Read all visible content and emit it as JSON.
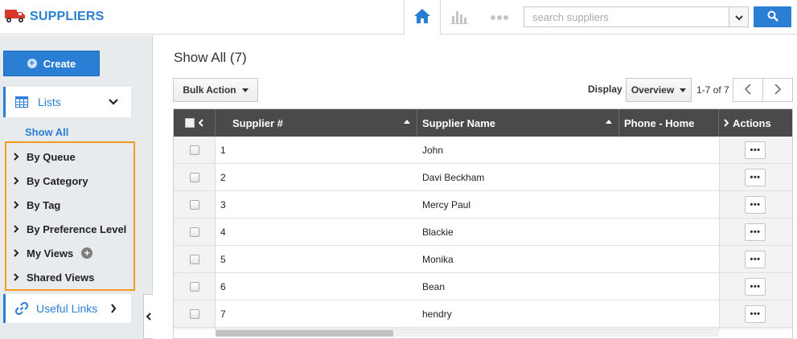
{
  "app": {
    "title": "SUPPLIERS",
    "brand_color": "#2a7fd4",
    "highlight_color": "#f39a1e"
  },
  "topnav": {
    "home_icon": "home-icon",
    "chart_icon": "bar-chart-icon",
    "more_icon": "more-dots-icon",
    "search_placeholder": "search suppliers",
    "search_icon": "search-icon"
  },
  "sidebar": {
    "create_label": "Create",
    "lists_label": "Lists",
    "show_all_label": "Show All",
    "queue_items": [
      {
        "label": "By Queue"
      },
      {
        "label": "By Category"
      },
      {
        "label": "By Tag"
      },
      {
        "label": "By Preference Level"
      },
      {
        "label": "My Views"
      },
      {
        "label": "Shared Views"
      }
    ],
    "useful_links_label": "Useful Links"
  },
  "main": {
    "title": "Show All (7)",
    "bulk_action_label": "Bulk Action",
    "display_label": "Display",
    "display_value": "Overview",
    "page_count": "1-7 of 7"
  },
  "table": {
    "headers": {
      "supplier_no": "Supplier #",
      "supplier_name": "Supplier Name",
      "phone_home": "Phone - Home",
      "actions": "Actions"
    },
    "action_glyph": "•••",
    "rows": [
      {
        "num": "1",
        "name": "John"
      },
      {
        "num": "2",
        "name": "Davi Beckham"
      },
      {
        "num": "3",
        "name": "Mercy Paul"
      },
      {
        "num": "4",
        "name": "Blackie"
      },
      {
        "num": "5",
        "name": "Monika"
      },
      {
        "num": "6",
        "name": "Bean"
      },
      {
        "num": "7",
        "name": "hendry"
      }
    ]
  }
}
